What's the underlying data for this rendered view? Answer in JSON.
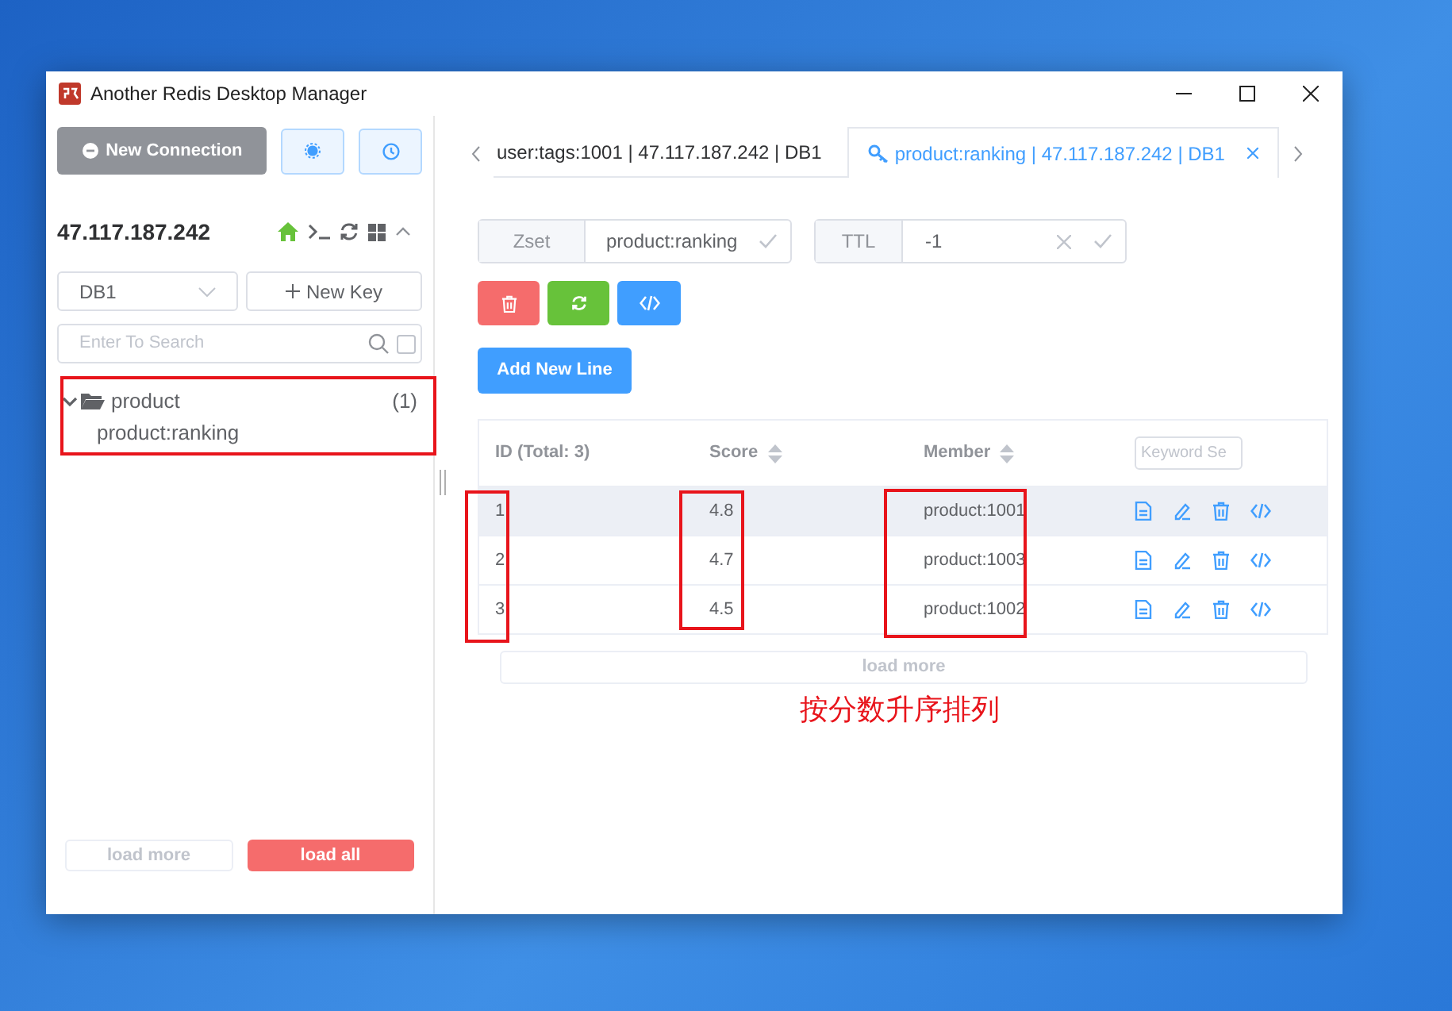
{
  "window": {
    "title": "Another Redis Desktop Manager"
  },
  "sidebar": {
    "new_connection": "New Connection",
    "connection": "47.117.187.242",
    "db_select": "DB1",
    "new_key": "New Key",
    "search": {
      "placeholder": "Enter To Search",
      "checked": false
    },
    "tree": [
      {
        "label": "product",
        "count": "(1)",
        "expanded": true,
        "children": [
          {
            "label": "product:ranking"
          }
        ]
      }
    ],
    "load_more": "load more",
    "load_all": "load all"
  },
  "tabs": [
    {
      "label": "user:tags:1001 | 47.117.187.242 | DB1",
      "selected": false
    },
    {
      "label": "product:ranking | 47.117.187.242 | DB1",
      "selected": true
    }
  ],
  "key": {
    "type": "Zset",
    "name": "product:ranking",
    "ttl_label": "TTL",
    "ttl": "-1"
  },
  "add_new_line": "Add New Line",
  "table": {
    "columns": [
      "ID (Total: 3)",
      "Score",
      "Member"
    ],
    "keyword_search": {
      "placeholder": "Keyword Se"
    },
    "rows": [
      {
        "id": "1",
        "score": "4.8",
        "member": "product:1001",
        "selected": true
      },
      {
        "id": "2",
        "score": "4.7",
        "member": "product:1003",
        "selected": false
      },
      {
        "id": "3",
        "score": "4.5",
        "member": "product:1002",
        "selected": false
      }
    ]
  },
  "load_more": "load more",
  "annotation": "按分数升序排列"
}
